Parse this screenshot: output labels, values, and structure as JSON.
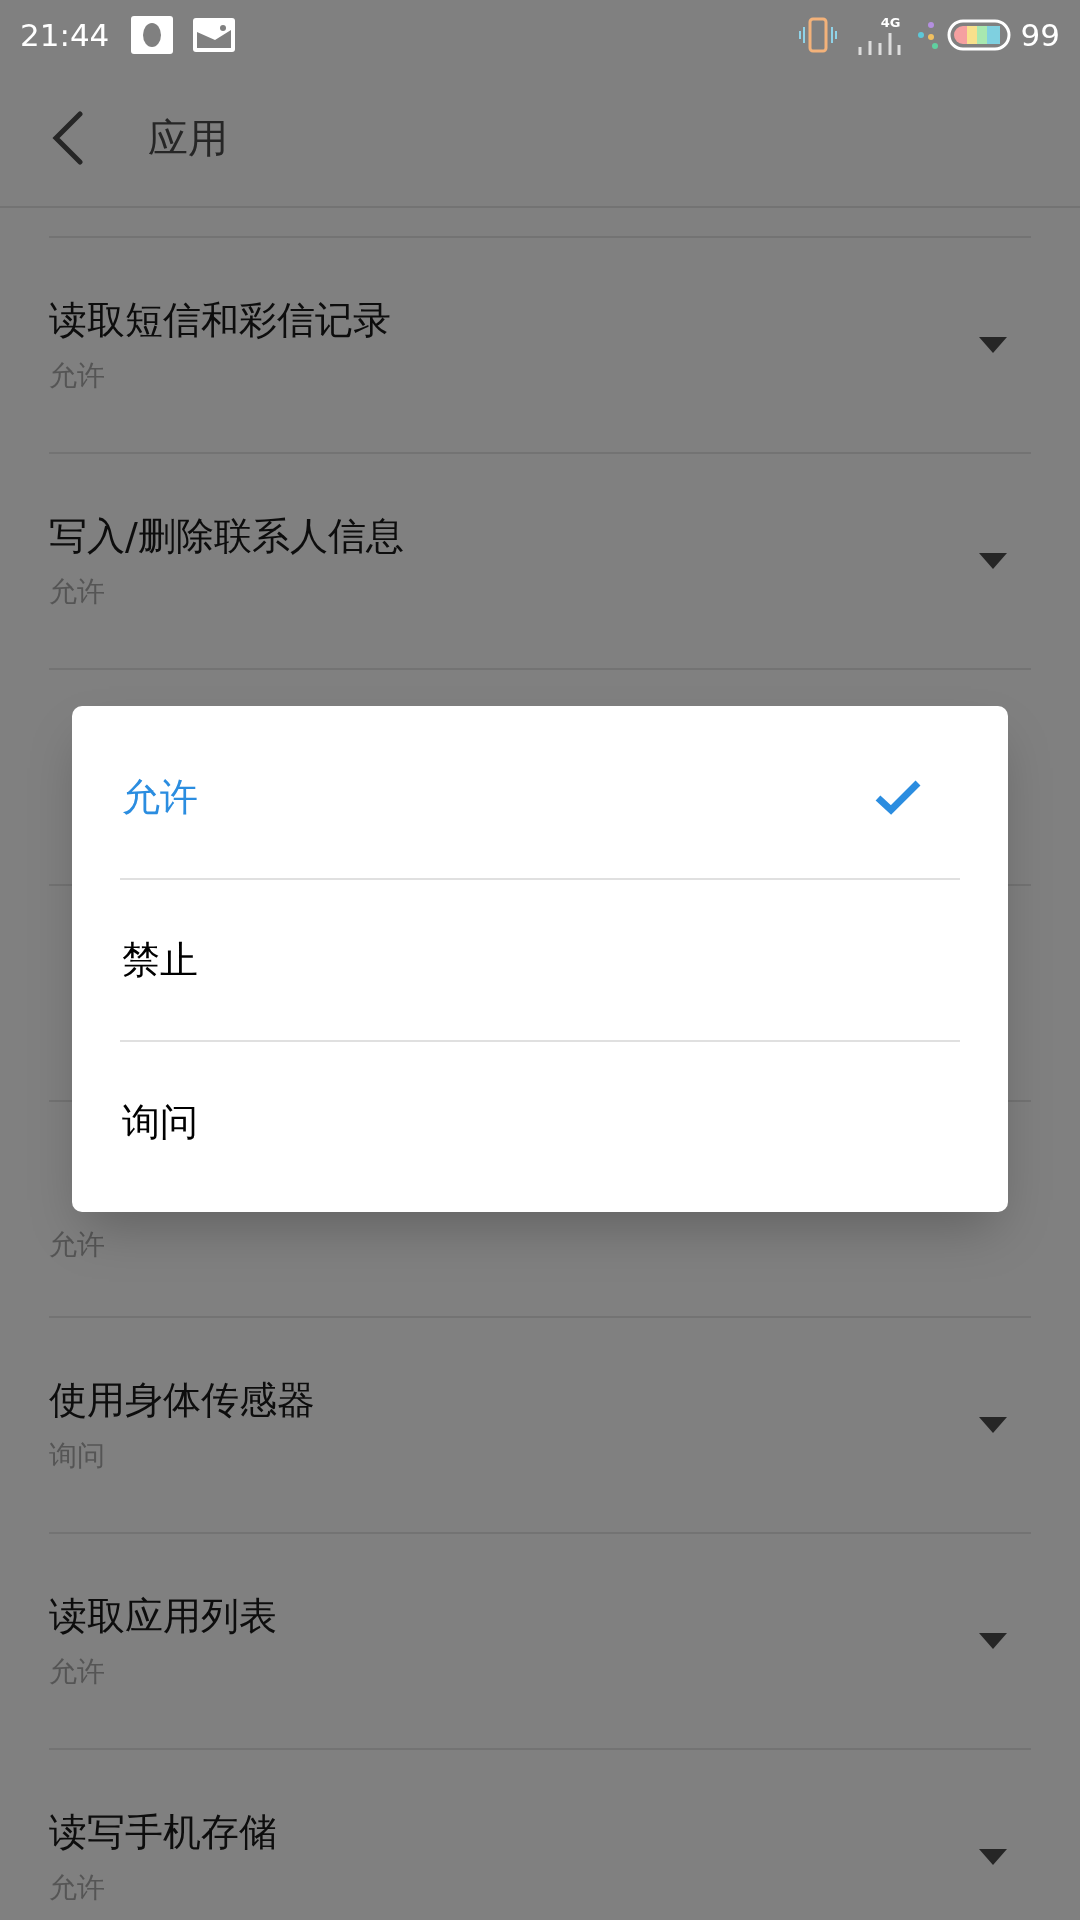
{
  "status_bar": {
    "time": "21:44",
    "network": "4G",
    "battery": "99"
  },
  "header": {
    "title": "应用"
  },
  "rows": [
    {
      "title": "读取短信和彩信记录",
      "value": "允许"
    },
    {
      "title": "写入/删除联系人信息",
      "value": "允许"
    },
    {},
    {},
    {
      "value": "允许"
    },
    {
      "title": "使用身体传感器",
      "value": "询问"
    },
    {
      "title": "读取应用列表",
      "value": "允许"
    },
    {
      "title": "读写手机存储",
      "value": "允许"
    }
  ],
  "dialog": {
    "options": [
      {
        "label": "允许",
        "selected": true
      },
      {
        "label": "禁止",
        "selected": false
      },
      {
        "label": "询问",
        "selected": false
      }
    ]
  }
}
